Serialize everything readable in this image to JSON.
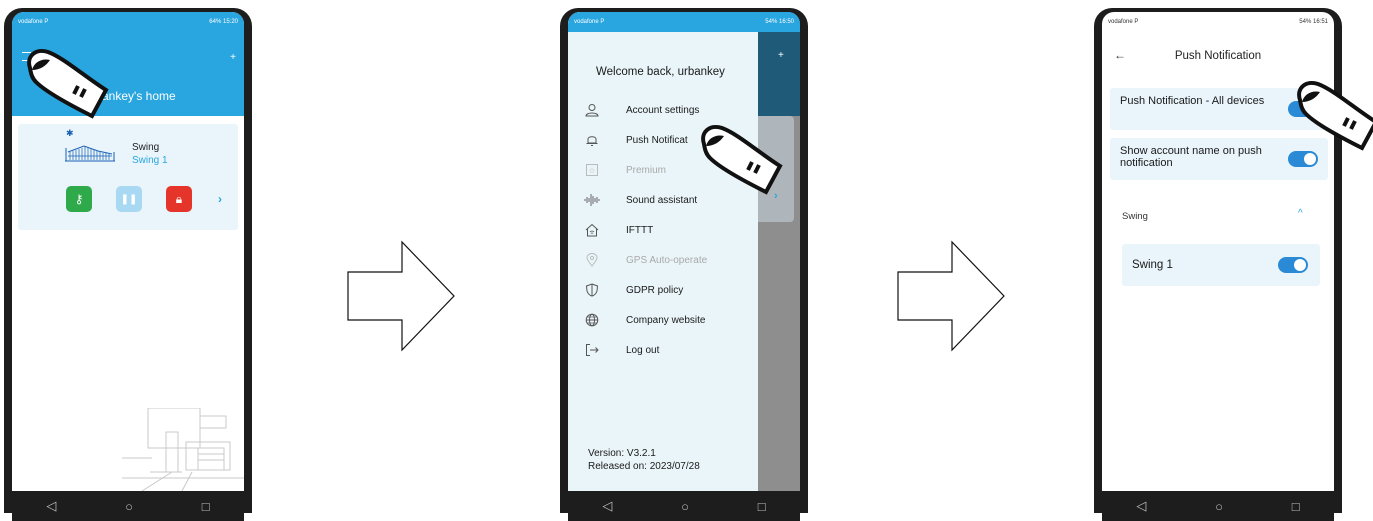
{
  "phone1": {
    "status": {
      "carrier": "vodafone P",
      "battery": "64%",
      "time": "15:20"
    },
    "header_title": "ankey's home",
    "plus": "+",
    "device": {
      "name": "Swing",
      "subname": "Swing 1"
    },
    "chevron": "›"
  },
  "phone2": {
    "status": {
      "carrier": "vodafone P",
      "battery": "54%",
      "time": "16:50"
    },
    "welcome": "Welcome back, urbankey",
    "menu": [
      {
        "label": "Account settings",
        "icon": "user-icon"
      },
      {
        "label": "Push Notificat",
        "icon": "bell-icon"
      },
      {
        "label": "Premium",
        "icon": "star-icon"
      },
      {
        "label": "Sound assistant",
        "icon": "soundwave-icon"
      },
      {
        "label": "IFTTT",
        "icon": "home-wifi-icon"
      },
      {
        "label": "GPS Auto-operate",
        "icon": "location-icon"
      },
      {
        "label": "GDPR policy",
        "icon": "shield-icon"
      },
      {
        "label": "Company website",
        "icon": "globe-icon"
      },
      {
        "label": "Log out",
        "icon": "logout-icon"
      }
    ],
    "version": "Version: V3.2.1",
    "released": "Released on: 2023/07/28"
  },
  "phone3": {
    "status": {
      "carrier": "vodafone P",
      "battery": "54%",
      "time": "16:51"
    },
    "title": "Push Notification",
    "back": "←",
    "settings": [
      {
        "label": "Push Notification - All devices",
        "enabled": true
      },
      {
        "label": "Show account name on push notification",
        "enabled": true
      }
    ],
    "group_label": "Swing",
    "group_chevron": "^",
    "device_label": "Swing 1",
    "device_enabled": true
  },
  "nav": {
    "back": "◁",
    "home": "○",
    "recent": "□"
  },
  "colors": {
    "accent": "#29a6df",
    "toggle": "#2a8ad6",
    "key_button": "#2faa4b",
    "lock_button": "#e5352b",
    "pause_button": "#a9d9f2"
  }
}
